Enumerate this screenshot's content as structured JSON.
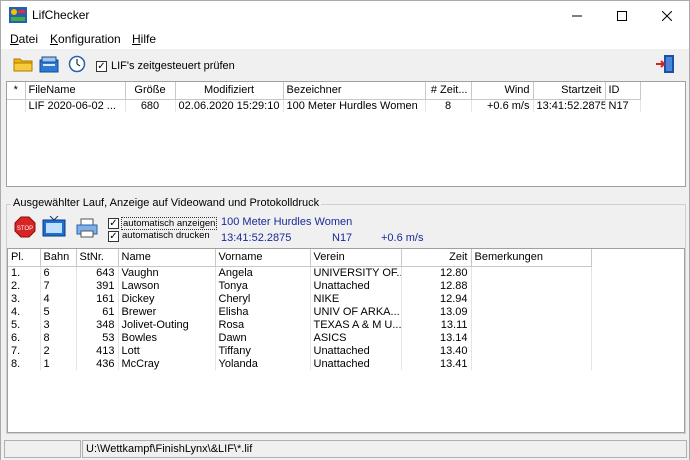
{
  "window": {
    "title": "LifChecker"
  },
  "menu": [
    {
      "label": "Datei",
      "underline": "D",
      "rest": "atei"
    },
    {
      "label": "Konfiguration",
      "underline": "K",
      "rest": "onfiguration"
    },
    {
      "label": "Hilfe",
      "underline": "H",
      "rest": "ilfe"
    }
  ],
  "toolbar": {
    "timed_check_label": "LIF's zeitgesteuert prüfen",
    "timed_check_checked": true
  },
  "files": {
    "columns": [
      "*",
      "FileName",
      "Größe",
      "Modifiziert",
      "Bezeichner",
      "# Zeit...",
      "Wind",
      "Startzeit",
      "ID"
    ],
    "rows": [
      {
        "star": "",
        "filename": "LIF 2020-06-02 ...",
        "size": "680",
        "modified": "02.06.2020 15:29:10",
        "name": "100 Meter Hurdles Women",
        "count": "8",
        "wind": "+0.6 m/s",
        "start": "13:41:52.2875",
        "id": "N17"
      }
    ]
  },
  "selected": {
    "group_title": "Ausgewählter Lauf, Anzeige auf Videowand und Protokolldruck",
    "auto_display_label": "automatisch anzeigen",
    "auto_display_checked": true,
    "auto_print_label": "automatisch drucken",
    "auto_print_checked": true,
    "event_name": "100 Meter Hurdles Women",
    "start_time": "13:41:52.2875",
    "id": "N17",
    "wind": "+0.6 m/s"
  },
  "results": {
    "columns": [
      "Pl.",
      "Bahn",
      "StNr.",
      "Name",
      "Vorname",
      "Verein",
      "Zeit",
      "Bemerkungen"
    ],
    "rows": [
      {
        "pl": "1.",
        "bahn": "6",
        "stnr": "643",
        "name": "Vaughn",
        "vorname": "Angela",
        "verein": "UNIVERSITY OF...",
        "zeit": "12.80",
        "bem": ""
      },
      {
        "pl": "2.",
        "bahn": "7",
        "stnr": "391",
        "name": "Lawson",
        "vorname": "Tonya",
        "verein": "Unattached",
        "zeit": "12.88",
        "bem": ""
      },
      {
        "pl": "3.",
        "bahn": "4",
        "stnr": "161",
        "name": "Dickey",
        "vorname": "Cheryl",
        "verein": "NIKE",
        "zeit": "12.94",
        "bem": ""
      },
      {
        "pl": "4.",
        "bahn": "5",
        "stnr": "61",
        "name": "Brewer",
        "vorname": "Elisha",
        "verein": "UNIV OF ARKA...",
        "zeit": "13.09",
        "bem": ""
      },
      {
        "pl": "5.",
        "bahn": "3",
        "stnr": "348",
        "name": "Jolivet-Outing",
        "vorname": "Rosa",
        "verein": "TEXAS A & M U...",
        "zeit": "13.11",
        "bem": ""
      },
      {
        "pl": "6.",
        "bahn": "8",
        "stnr": "53",
        "name": "Bowles",
        "vorname": "Dawn",
        "verein": "ASICS",
        "zeit": "13.14",
        "bem": ""
      },
      {
        "pl": "7.",
        "bahn": "2",
        "stnr": "413",
        "name": "Lott",
        "vorname": "Tiffany",
        "verein": "Unattached",
        "zeit": "13.40",
        "bem": ""
      },
      {
        "pl": "8.",
        "bahn": "1",
        "stnr": "436",
        "name": "McCray",
        "vorname": "Yolanda",
        "verein": "Unattached",
        "zeit": "13.41",
        "bem": ""
      }
    ]
  },
  "status": {
    "left": "",
    "path": "U:\\Wettkampf\\FinishLynx\\&LIF\\*.lif"
  },
  "colors": {
    "accent_text": "#1a2a9a",
    "window_bg": "#f0f0f0",
    "exit_icon": "#1e4fa8"
  }
}
